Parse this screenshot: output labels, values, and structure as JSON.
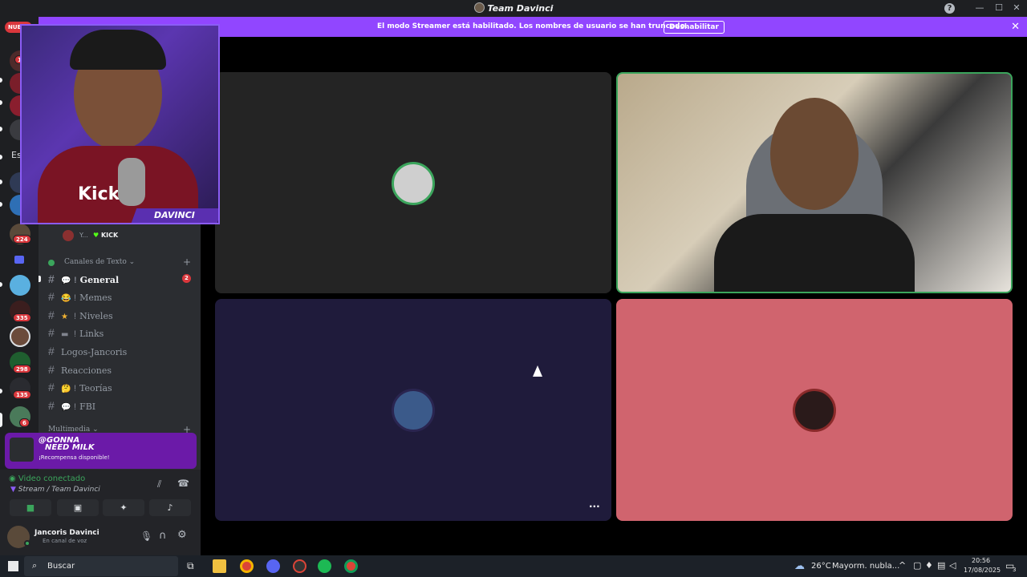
{
  "window": {
    "title": "Team Davinci",
    "help_label": "?",
    "minimize": "—",
    "maximize": "☐",
    "close": "✕"
  },
  "banner": {
    "message": "El modo Streamer está habilitado. Los nombres de usuario se han truncado.",
    "button": "Deshabilitar",
    "close": "✕"
  },
  "rail": {
    "new_label": "NUE",
    "badges": [
      "1",
      "224",
      "335",
      "298",
      "135",
      "6"
    ],
    "text_item": "Es"
  },
  "webcam_overlay": {
    "brand": "DAVINCI",
    "shirt_text": "Kick"
  },
  "voice_user": {
    "name": "Y...",
    "platform": "KICK"
  },
  "channels": {
    "category_text": "Canales de Texto",
    "category_media": "Multimedia",
    "items": [
      {
        "name": "General",
        "emoji": "💬",
        "sep": "!",
        "badge": "2"
      },
      {
        "name": "Memes",
        "emoji": "😂",
        "sep": "!"
      },
      {
        "name": "Niveles",
        "emoji": "★",
        "sep": "!"
      },
      {
        "name": "Links",
        "emoji": "▬",
        "sep": "!"
      },
      {
        "name": "Logos-Jancoris",
        "emoji": "",
        "sep": ""
      },
      {
        "name": "Reacciones",
        "emoji": "",
        "sep": ""
      },
      {
        "name": "Teorías",
        "emoji": "🤔",
        "sep": "!"
      },
      {
        "name": "FBI",
        "emoji": "💬",
        "sep": "!"
      }
    ]
  },
  "promo": {
    "handle": "@GONNA",
    "handle2": "NEED MILK",
    "reward": "¡Recompensa disponible!"
  },
  "voice": {
    "status": "Video conectado",
    "location": "Stream / Team Davinci"
  },
  "user": {
    "name": "Jancoris Davinci",
    "status": "En canal de voz"
  },
  "tiles": {
    "more": "···"
  },
  "colors": {
    "streamer_banner": "#9146ff",
    "speaking_border": "#3ba55c",
    "tile_dark": "#242424",
    "tile_indigo": "#1f1b3b",
    "tile_pink": "#d0646e"
  },
  "taskbar": {
    "search_placeholder": "Buscar",
    "weather_temp": "26°C",
    "weather_text": "Mayorm. nubla...",
    "time": "20:56",
    "date": "17/08/2025",
    "notif_count": "3"
  }
}
